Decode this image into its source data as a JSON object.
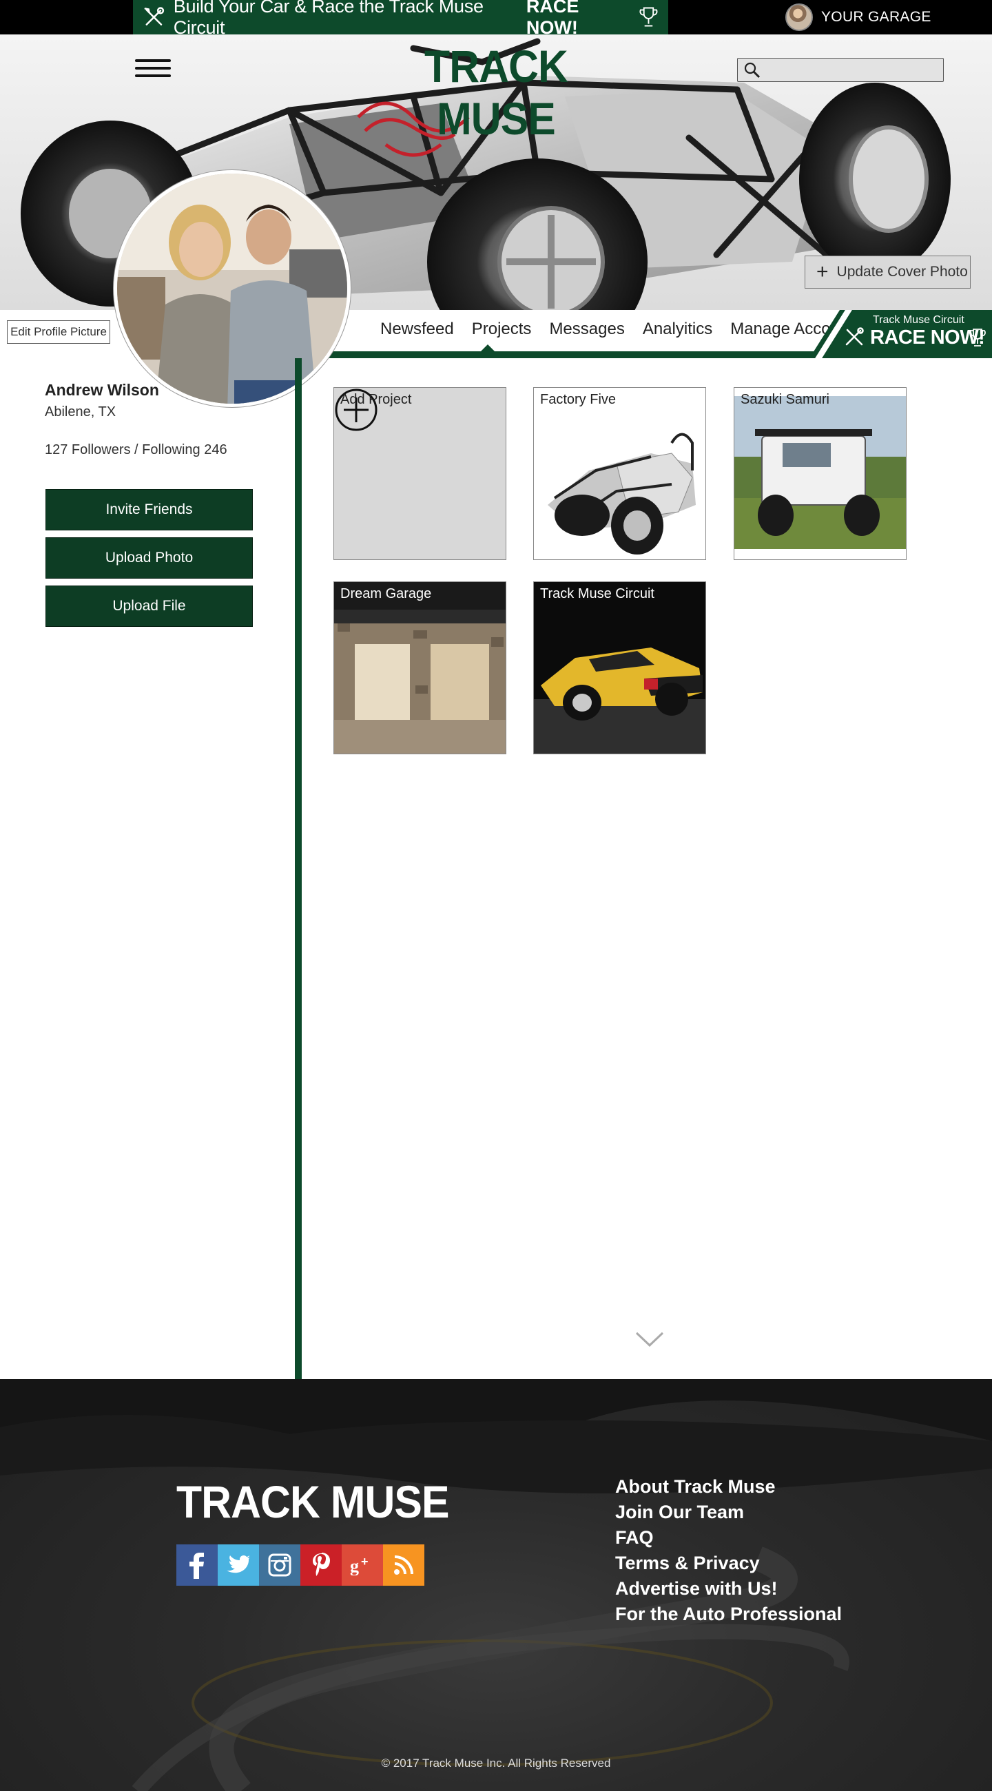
{
  "promo_bar": {
    "text": "Build Your Car & Race the Track Muse Circuit",
    "cta": "RACE NOW!",
    "tools_icon": "wrench-screwdriver-icon",
    "trophy_icon": "trophy-icon"
  },
  "account": {
    "label": "YOUR GARAGE"
  },
  "header": {
    "logo": "TRACK MUSE",
    "search": {
      "value": "",
      "placeholder": ""
    }
  },
  "cover": {
    "update_label": "Update Cover Photo",
    "edit_picture_label": "Edit Profile Picture"
  },
  "tabs": [
    {
      "label": "Newsfeed",
      "active": false
    },
    {
      "label": "Projects",
      "active": true
    },
    {
      "label": "Messages",
      "active": false
    },
    {
      "label": "Analyitics",
      "active": false
    },
    {
      "label": "Manage Account",
      "active": false
    }
  ],
  "race_badge": {
    "small": "Track Muse Circuit",
    "big": "RACE NOW!"
  },
  "profile": {
    "name": "Andrew Wilson",
    "location": "Abilene, TX",
    "stats": "127 Followers / Following 246",
    "buttons": [
      "Invite Friends",
      "Upload Photo",
      "Upload File"
    ]
  },
  "projects": [
    {
      "title": "Add Project"
    },
    {
      "title": "Factory Five"
    },
    {
      "title": "Sazuki Samuri"
    },
    {
      "title": "Dream Garage"
    },
    {
      "title": "Track Muse Circuit"
    }
  ],
  "footer": {
    "logo": "TRACK MUSE",
    "social": [
      "facebook-icon",
      "twitter-icon",
      "instagram-icon",
      "pinterest-icon",
      "google-plus-icon",
      "rss-icon"
    ],
    "links": [
      "About Track Muse",
      "Join Our Team",
      "FAQ",
      "Terms & Privacy",
      "Advertise with Us!",
      "For the Auto Professional"
    ],
    "copyright": "© 2017 Track Muse Inc. All Rights Reserved"
  },
  "colors": {
    "brand_green": "#0d4a2b",
    "button_green": "#0d3d24",
    "facebook": "#3b5998",
    "twitter": "#4ab3e1",
    "instagram": "#3f729b",
    "pinterest": "#cb2027",
    "google_plus": "#dd4b39",
    "rss": "#f79421"
  }
}
